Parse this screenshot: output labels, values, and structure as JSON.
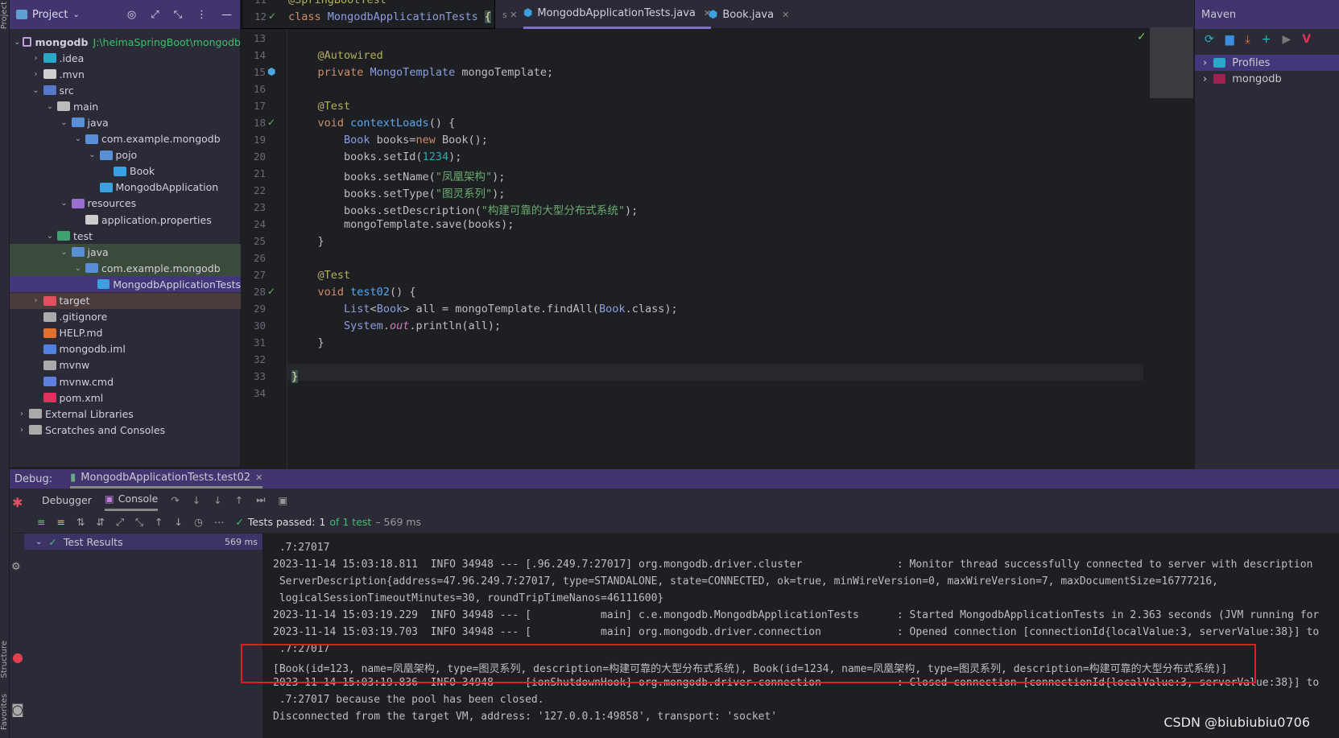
{
  "project": {
    "title": "Project",
    "root": {
      "name": "mongodb",
      "path": "J:\\heimaSpringBoot\\mongodb"
    },
    "items": [
      {
        "label": ".idea",
        "depth": 1,
        "arrow": ">",
        "color": "#2aa7c9"
      },
      {
        "label": ".mvn",
        "depth": 1,
        "arrow": ">",
        "color": "#cfcfcf"
      },
      {
        "label": "src",
        "depth": 1,
        "arrow": "v",
        "color": "#5577cc"
      },
      {
        "label": "main",
        "depth": 2,
        "arrow": "v",
        "color": "#bbbbbb"
      },
      {
        "label": "java",
        "depth": 3,
        "arrow": "v",
        "color": "#5a8fd6"
      },
      {
        "label": "com.example.mongodb",
        "depth": 4,
        "arrow": "v",
        "color": "#5a8fd6"
      },
      {
        "label": "pojo",
        "depth": 5,
        "arrow": "v",
        "color": "#5a8fd6"
      },
      {
        "label": "Book",
        "depth": 6,
        "arrow": "",
        "color": "#3aa0e0"
      },
      {
        "label": "MongodbApplication",
        "depth": 5,
        "arrow": "",
        "color": "#3aa0e0"
      },
      {
        "label": "resources",
        "depth": 3,
        "arrow": "v",
        "color": "#9a6fd0"
      },
      {
        "label": "application.properties",
        "depth": 4,
        "arrow": "",
        "color": "#cccccc"
      },
      {
        "label": "test",
        "depth": 2,
        "arrow": "v",
        "color": "#3fa070"
      },
      {
        "label": "java",
        "depth": 3,
        "arrow": "v",
        "color": "#5a8fd6",
        "state": "hl"
      },
      {
        "label": "com.example.mongodb",
        "depth": 4,
        "arrow": "v",
        "color": "#5a8fd6",
        "state": "hl"
      },
      {
        "label": "MongodbApplicationTests",
        "depth": 5,
        "arrow": "",
        "color": "#3aa0e0",
        "state": "sel"
      },
      {
        "label": "target",
        "depth": 1,
        "arrow": ">",
        "color": "#e05060",
        "state": "tg"
      },
      {
        "label": ".gitignore",
        "depth": 1,
        "arrow": "",
        "color": "#aaaaaa"
      },
      {
        "label": "HELP.md",
        "depth": 1,
        "arrow": "",
        "color": "#e07030"
      },
      {
        "label": "mongodb.iml",
        "depth": 1,
        "arrow": "",
        "color": "#5080e0"
      },
      {
        "label": "mvnw",
        "depth": 1,
        "arrow": "",
        "color": "#aaaaaa"
      },
      {
        "label": "mvnw.cmd",
        "depth": 1,
        "arrow": "",
        "color": "#6080e0"
      },
      {
        "label": "pom.xml",
        "depth": 1,
        "arrow": "",
        "color": "#e03060"
      },
      {
        "label": "External Libraries",
        "depth": 0,
        "arrow": ">",
        "color": "#aaaaaa"
      },
      {
        "label": "Scratches and Consoles",
        "depth": 0,
        "arrow": ">",
        "color": "#aaaaaa"
      }
    ]
  },
  "tabs": [
    {
      "label": "MongodbApplicationTests.java",
      "active": true
    },
    {
      "label": "Book.java",
      "active": false
    }
  ],
  "sticky": [
    {
      "ln": "11",
      "tokens": [
        [
          "@SpringBootTest",
          "an"
        ]
      ]
    },
    {
      "ln": "12",
      "tokens": [
        [
          "class ",
          "kw"
        ],
        [
          "MongodbApplicationTests ",
          "ty"
        ],
        [
          "{",
          "br"
        ]
      ]
    }
  ],
  "code": [
    {
      "ln": "13",
      "tokens": []
    },
    {
      "ln": "14",
      "tokens": [
        [
          "    "
        ],
        [
          "@Autowired",
          "an"
        ]
      ]
    },
    {
      "ln": "15",
      "tokens": [
        [
          "    "
        ],
        [
          "private ",
          "kw"
        ],
        [
          "MongoTemplate ",
          "ty"
        ],
        [
          "mongoTemplate;"
        ]
      ]
    },
    {
      "ln": "16",
      "tokens": []
    },
    {
      "ln": "17",
      "tokens": [
        [
          "    "
        ],
        [
          "@Test",
          "an"
        ]
      ]
    },
    {
      "ln": "18",
      "tokens": [
        [
          "    "
        ],
        [
          "void ",
          "kw"
        ],
        [
          "contextLoads",
          "fn"
        ],
        [
          "() {"
        ]
      ]
    },
    {
      "ln": "19",
      "tokens": [
        [
          "        "
        ],
        [
          "Book ",
          "ty"
        ],
        [
          "books="
        ],
        [
          "new ",
          "kw"
        ],
        [
          "Book();"
        ]
      ]
    },
    {
      "ln": "20",
      "tokens": [
        [
          "        books.setId("
        ],
        [
          "1234",
          "nm"
        ],
        [
          ");"
        ]
      ]
    },
    {
      "ln": "21",
      "tokens": [
        [
          "        books.setName("
        ],
        [
          "\"凤凰架构\"",
          "st"
        ],
        [
          ");"
        ]
      ]
    },
    {
      "ln": "22",
      "tokens": [
        [
          "        books.setType("
        ],
        [
          "\"图灵系列\"",
          "st"
        ],
        [
          ");"
        ]
      ]
    },
    {
      "ln": "23",
      "tokens": [
        [
          "        books.setDescription("
        ],
        [
          "\"构建可靠的大型分布式系统\"",
          "st"
        ],
        [
          ");"
        ]
      ]
    },
    {
      "ln": "24",
      "tokens": [
        [
          "        mongoTemplate.save(books);"
        ]
      ]
    },
    {
      "ln": "25",
      "tokens": [
        [
          "    }"
        ]
      ]
    },
    {
      "ln": "26",
      "tokens": []
    },
    {
      "ln": "27",
      "tokens": [
        [
          "    "
        ],
        [
          "@Test",
          "an"
        ]
      ]
    },
    {
      "ln": "28",
      "tokens": [
        [
          "    "
        ],
        [
          "void ",
          "kw"
        ],
        [
          "test02",
          "fn"
        ],
        [
          "() {"
        ]
      ]
    },
    {
      "ln": "29",
      "tokens": [
        [
          "        "
        ],
        [
          "List",
          "ty"
        ],
        [
          "<"
        ],
        [
          "Book",
          "ty"
        ],
        [
          "> all = mongoTemplate.findAll("
        ],
        [
          "Book",
          "ty"
        ],
        [
          ".class);"
        ]
      ]
    },
    {
      "ln": "30",
      "tokens": [
        [
          "        "
        ],
        [
          "System",
          "ty"
        ],
        [
          "."
        ],
        [
          "out",
          "it"
        ],
        [
          ".println(all);"
        ]
      ]
    },
    {
      "ln": "31",
      "tokens": [
        [
          "    }"
        ]
      ]
    },
    {
      "ln": "32",
      "tokens": []
    },
    {
      "ln": "33",
      "tokens": [
        [
          "}",
          "br"
        ]
      ]
    },
    {
      "ln": "34",
      "tokens": []
    }
  ],
  "maven": {
    "title": "Maven",
    "items": [
      {
        "label": "Profiles",
        "selected": true
      },
      {
        "label": "mongodb",
        "selected": false
      }
    ]
  },
  "debug": {
    "label": "Debug:",
    "tab": "MongodbApplicationTests.test02",
    "debugger": "Debugger",
    "console": "Console"
  },
  "tests": {
    "prefix": "Tests passed:",
    "count": "1",
    "of": "of 1 test",
    "time": "– 569 ms",
    "results_label": "Test Results",
    "results_time": "569 ms"
  },
  "console": [
    " .7:27017",
    "2023-11-14 15:03:18.811  INFO 34948 --- [.96.249.7:27017] org.mongodb.driver.cluster               : Monitor thread successfully connected to server with description",
    " ServerDescription{address=47.96.249.7:27017, type=STANDALONE, state=CONNECTED, ok=true, minWireVersion=0, maxWireVersion=7, maxDocumentSize=16777216,",
    " logicalSessionTimeoutMinutes=30, roundTripTimeNanos=46111600}",
    "2023-11-14 15:03:19.229  INFO 34948 --- [           main] c.e.mongodb.MongodbApplicationTests      : Started MongodbApplicationTests in 2.363 seconds (JVM running for",
    "2023-11-14 15:03:19.703  INFO 34948 --- [           main] org.mongodb.driver.connection            : Opened connection [connectionId{localValue:3, serverValue:38}] to",
    " .7:27017",
    "[Book(id=123, name=凤凰架构, type=图灵系列, description=构建可靠的大型分布式系统), Book(id=1234, name=凤凰架构, type=图灵系列, description=构建可靠的大型分布式系统)]",
    "2023-11-14 15:03:19.836  INFO 34948 --- [ionShutdownHook] org.mongodb.driver.connection            : Closed connection [connectionId{localValue:3, serverValue:38}] to",
    " .7:27017 because the pool has been closed.",
    "Disconnected from the target VM, address: '127.0.0.1:49858', transport: 'socket'"
  ],
  "left_strip": {
    "project": "Project",
    "structure": "Structure",
    "favorites": "Favorites"
  },
  "watermark": "CSDN @biubiubiu0706",
  "colors": {
    "accent": "#41346f",
    "highlight_box": "#e02020",
    "pass": "#3fbf6f"
  }
}
